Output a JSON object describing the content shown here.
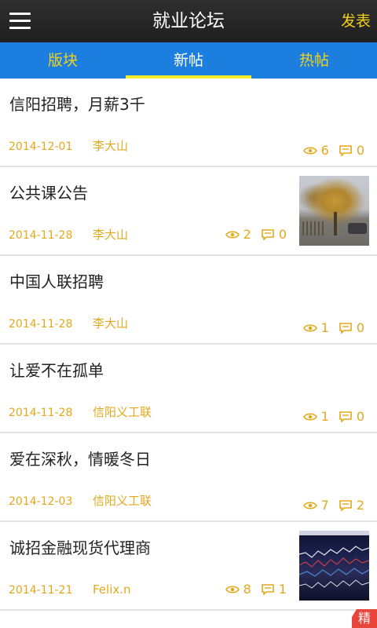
{
  "header": {
    "title": "就业论坛",
    "action_label": "发表"
  },
  "tabs": [
    {
      "label": "版块",
      "active": false
    },
    {
      "label": "新帖",
      "active": true
    },
    {
      "label": "热帖",
      "active": false
    }
  ],
  "posts": [
    {
      "title": "信阳招聘，月薪3千",
      "date": "2014-12-01",
      "author": "李大山",
      "views": "6",
      "comments": "0",
      "thumbnail": false
    },
    {
      "title": "公共课公告",
      "date": "2014-11-28",
      "author": "李大山",
      "views": "2",
      "comments": "0",
      "thumbnail": "autumn-tree-photo"
    },
    {
      "title": "中国人联招聘",
      "date": "2014-11-28",
      "author": "李大山",
      "views": "1",
      "comments": "0",
      "thumbnail": false
    },
    {
      "title": "让爱不在孤单",
      "date": "2014-11-28",
      "author": "信阳义工联",
      "views": "1",
      "comments": "0",
      "thumbnail": false
    },
    {
      "title": "爱在深秋，情暖冬日",
      "date": "2014-12-03",
      "author": "信阳义工联",
      "views": "7",
      "comments": "2",
      "thumbnail": false
    },
    {
      "title": "诚招金融现货代理商",
      "date": "2014-11-21",
      "author": "Felix.n",
      "views": "8",
      "comments": "1",
      "thumbnail": "stock-chart-screen"
    }
  ],
  "badge": "精",
  "colors": {
    "header_bg": "#262626",
    "tab_bg": "#1c7fe0",
    "accent_yellow": "#f2d21a",
    "meta_orange": "#e3a81c",
    "badge_red": "#e8463a"
  },
  "icons": {
    "menu": "hamburger-menu-icon",
    "views": "eye-icon",
    "comments": "comment-bubble-icon"
  }
}
